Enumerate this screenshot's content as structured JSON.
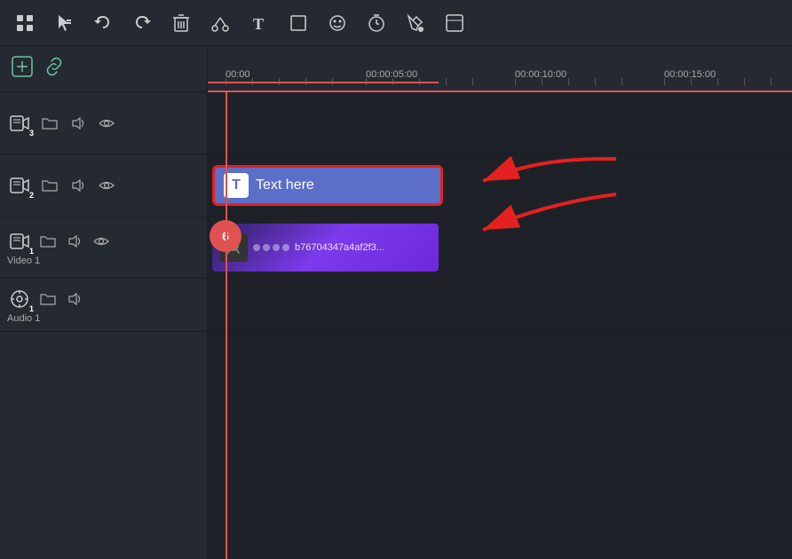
{
  "toolbar": {
    "buttons": [
      {
        "id": "grid",
        "icon": "⊞",
        "label": "Grid"
      },
      {
        "id": "select",
        "icon": "↖",
        "label": "Select"
      },
      {
        "id": "undo",
        "icon": "↩",
        "label": "Undo"
      },
      {
        "id": "redo",
        "icon": "↪",
        "label": "Redo"
      },
      {
        "id": "delete",
        "icon": "🗑",
        "label": "Delete"
      },
      {
        "id": "cut",
        "icon": "✂",
        "label": "Cut"
      },
      {
        "id": "text",
        "icon": "T",
        "label": "Text"
      },
      {
        "id": "crop",
        "icon": "⬜",
        "label": "Crop"
      },
      {
        "id": "effects",
        "icon": "☺",
        "label": "Effects"
      },
      {
        "id": "timer",
        "icon": "⏱",
        "label": "Timer"
      },
      {
        "id": "paint",
        "icon": "🖊",
        "label": "Paint bucket"
      },
      {
        "id": "more",
        "icon": "⋯",
        "label": "More"
      }
    ]
  },
  "timeline_header": {
    "add_track_icon": "+",
    "link_icon": "🔗",
    "timestamps": [
      "00:00",
      "00:00:05:00",
      "00:00:10:00",
      "00:00:15:00"
    ]
  },
  "tracks": [
    {
      "id": "track3",
      "number": "3",
      "type": "video",
      "icons": [
        "folder",
        "volume",
        "eye"
      ]
    },
    {
      "id": "track2",
      "number": "2",
      "type": "video",
      "icons": [
        "folder",
        "volume",
        "eye"
      ],
      "clip": {
        "type": "text",
        "label": "Text here",
        "icon": "T"
      }
    },
    {
      "id": "track1",
      "number": "1",
      "type": "video",
      "icons": [
        "folder",
        "volume",
        "eye"
      ],
      "label": "Video 1",
      "clip": {
        "type": "video",
        "filename": "b76704347a4af2f3..."
      }
    },
    {
      "id": "audio1",
      "number": "1",
      "type": "audio",
      "icons": [
        "folder",
        "volume"
      ],
      "label": "Audio 1"
    }
  ],
  "red_circle": {
    "number": "6"
  },
  "colors": {
    "accent_red": "#e52020",
    "text_clip_bg": "#5b6ec8",
    "video_clip_bg": "#7c3aed",
    "toolbar_bg": "#252a32",
    "timeline_bg": "#1e2228",
    "track_label": "#aaaaaa"
  }
}
